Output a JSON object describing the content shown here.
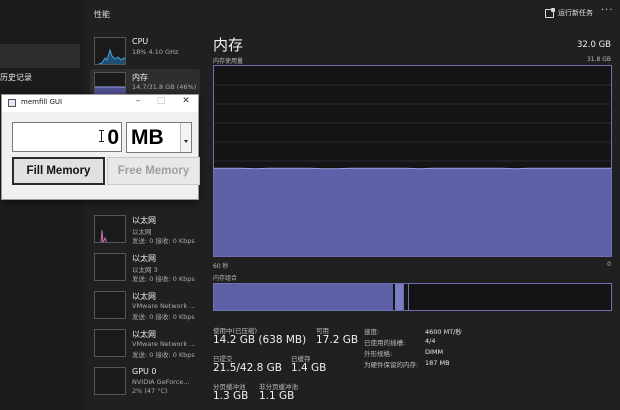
{
  "window": {
    "title": "性能",
    "run_new_task": "运行新任务",
    "more": "···"
  },
  "nav": {
    "visible_item_fragment": "历史记录"
  },
  "colors": {
    "accent": "#6d6fb4",
    "memory_fill": "#5f61a8",
    "graph_line": "#9aa0e0",
    "cpu_line": "#4ba3e0",
    "eth_line": "#c470b8"
  },
  "perf_list": [
    {
      "title": "CPU",
      "sub1": "18% 4.10 GHz",
      "sub2": "",
      "graph": "cpu"
    },
    {
      "title": "内存",
      "sub1": "14.7/31.8 GB (46%)",
      "sub2": "",
      "graph": "memory"
    },
    {
      "title": "以太网",
      "sub1": "以太网",
      "sub2": "发送: 0 接收: 0 Kbps",
      "graph": "ethernet"
    },
    {
      "title": "以太网",
      "sub1": "以太网 3",
      "sub2": "发送: 0 接收: 0 Kbps",
      "graph": "none"
    },
    {
      "title": "以太网",
      "sub1": "VMware Network ...",
      "sub2": "发送: 0 接收: 0 Kbps",
      "graph": "none"
    },
    {
      "title": "以太网",
      "sub1": "VMware Network ...",
      "sub2": "发送: 0 接收: 0 Kbps",
      "graph": "none"
    },
    {
      "title": "GPU 0",
      "sub1": "NVIDIA GeForce...",
      "sub2": "2% (47 °C)",
      "graph": "none"
    }
  ],
  "main": {
    "title": "内存",
    "total": "32.0 GB",
    "usage_label": "内存使用量",
    "usage_max": "31.8 GB",
    "axis_left": "60 秒",
    "axis_right": "0",
    "composition_label": "内存组合",
    "composition": {
      "in_use_fraction": 0.452,
      "modified_fraction": 0.018,
      "standby_fraction": 0.017
    }
  },
  "stats": {
    "in_use_label": "使用中(已压缩)",
    "in_use_value": "14.2 GB (638 MB)",
    "available_label": "可用",
    "available_value": "17.2 GB",
    "committed_label": "已提交",
    "committed_value": "21.5/42.8 GB",
    "cached_label": "已缓存",
    "cached_value": "1.4 GB",
    "paged_label": "分页缓冲池",
    "paged_value": "1.3 GB",
    "nonpaged_label": "非分页缓冲池",
    "nonpaged_value": "1.1 GB"
  },
  "details": [
    {
      "key": "速度:",
      "value": "4600 MT/秒"
    },
    {
      "key": "已使用的插槽:",
      "value": "4/4"
    },
    {
      "key": "外形规格:",
      "value": "DIMM"
    },
    {
      "key": "为硬件保留的内存:",
      "value": "187 MB"
    }
  ],
  "memfill": {
    "title": "memfill GUI",
    "minimize": "–",
    "maximize": "□",
    "close": "✕",
    "amount_value": "0",
    "unit_value": "MB",
    "fill_button": "Fill Memory",
    "free_button": "Free Memory"
  },
  "chart_data": {
    "type": "area",
    "title": "内存使用量",
    "ylim": [
      0,
      31.8
    ],
    "x_range_seconds": [
      60,
      0
    ],
    "series": [
      {
        "values": [
          14.7,
          14.7,
          14.7,
          14.6,
          14.7,
          14.7,
          14.7,
          14.7,
          14.6,
          14.6,
          14.7,
          14.7,
          14.7,
          14.7,
          14.7,
          14.6,
          14.7,
          14.7,
          14.7,
          14.7,
          14.7,
          14.7,
          14.6,
          14.7,
          14.7,
          14.7,
          14.7,
          14.7,
          14.7,
          14.7
        ]
      }
    ]
  }
}
